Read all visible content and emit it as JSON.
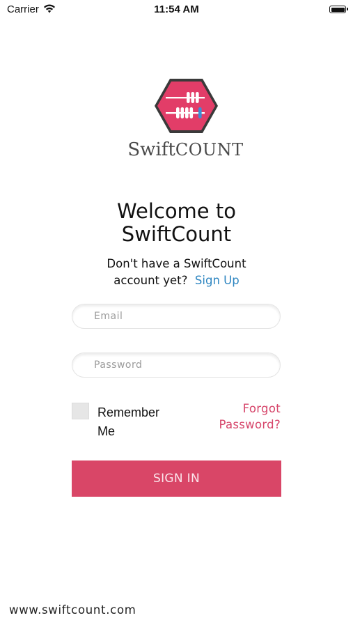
{
  "status_bar": {
    "carrier": "Carrier",
    "time": "11:54 AM"
  },
  "logo": {
    "text_part1": "Swift",
    "text_part2": "COUNT",
    "color_primary": "#e23d68",
    "color_hex_frame": "#3a3a3a",
    "color_accent": "#3b8fd6"
  },
  "welcome": {
    "line1": "Welcome to",
    "line2": "SwiftCount"
  },
  "signup": {
    "prompt_line1": "Don't have a SwiftCount",
    "prompt_line2": "account yet?",
    "link": "Sign Up"
  },
  "form": {
    "email_placeholder": "Email",
    "password_placeholder": "Password",
    "email_value": "",
    "password_value": "",
    "remember_line1": "Remember",
    "remember_line2": "Me",
    "remember_checked": false,
    "forgot_line1": "Forgot",
    "forgot_line2": "Password?",
    "sign_in_label": "SIGN IN"
  },
  "footer": {
    "url": "www.swiftcount.com"
  },
  "colors": {
    "accent_pink": "#d94667",
    "link_blue": "#2e86c1"
  }
}
